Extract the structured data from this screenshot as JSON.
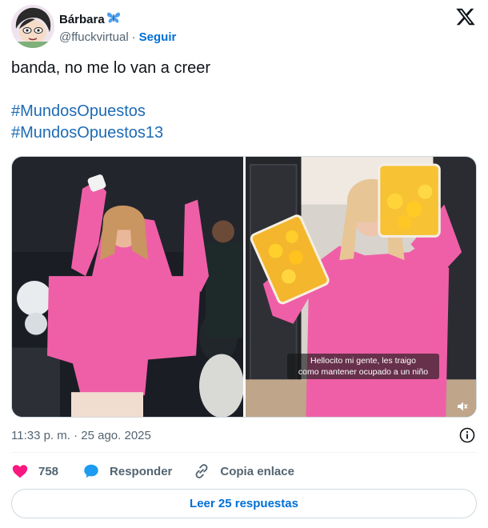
{
  "author": {
    "display_name": "Bárbara",
    "name_emoji_icon": "butterfly-icon",
    "handle": "@ffuckvirtual",
    "separator": "·",
    "follow_label": "Seguir"
  },
  "brand": {
    "logo_icon": "x-logo-icon"
  },
  "tweet": {
    "line1": "banda, no me lo van a creer",
    "hashtag1": "#MundosOpuestos",
    "hashtag2": "#MundosOpuestos13"
  },
  "media": {
    "caption_line1": "Hellocito mi gente, les traigo",
    "caption_line2": "como mantener ocupado a un niño",
    "mute_icon": "volume-mute-icon"
  },
  "meta": {
    "timestamp": "11:33 p. m. · 25 ago. 2025",
    "info_icon": "info-icon"
  },
  "actions": {
    "like_count": "758",
    "reply_label": "Responder",
    "copy_label": "Copia enlace"
  },
  "footer": {
    "read_replies_label": "Leer 25 respuestas"
  },
  "colors": {
    "link_blue": "#006fd6",
    "hashtag_blue": "#1d6bb5",
    "like_pink": "#f91880",
    "reply_blue": "#1d9bf0",
    "muted_text": "#536471",
    "hoodie_pink": "#ef5fa7"
  }
}
